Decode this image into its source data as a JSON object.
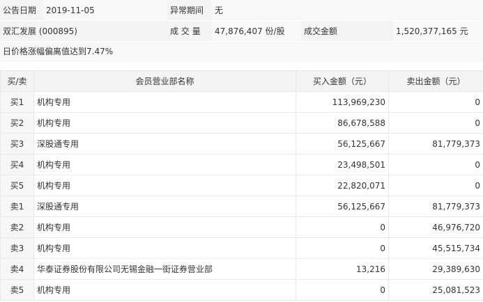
{
  "header": {
    "announce_date_label": "公告日期",
    "announce_date_value": "2019-11-05",
    "abnormal_period_label": "异常期间",
    "abnormal_period_value": "无",
    "stock_name": "双汇发展 (000895)",
    "volume_label": "成 交 量",
    "volume_value": "47,876,407 份/股",
    "amount_label": "成交金额",
    "amount_value": "1,520,377,165 元"
  },
  "reason": "日价格涨幅偏离值达到7.47%",
  "table": {
    "columns": [
      "买/卖",
      "会员营业部名称",
      "买入金额（元）",
      "卖出金额（元）"
    ],
    "rows": [
      {
        "side": "买1",
        "name": "机构专用",
        "buy": "113,969,230",
        "sell": "0"
      },
      {
        "side": "买2",
        "name": "机构专用",
        "buy": "86,678,588",
        "sell": "0"
      },
      {
        "side": "买3",
        "name": "深股通专用",
        "buy": "56,125,667",
        "sell": "81,779,373"
      },
      {
        "side": "买4",
        "name": "机构专用",
        "buy": "23,498,501",
        "sell": "0"
      },
      {
        "side": "买5",
        "name": "机构专用",
        "buy": "22,820,071",
        "sell": "0"
      },
      {
        "side": "卖1",
        "name": "深股通专用",
        "buy": "56,125,667",
        "sell": "81,779,373"
      },
      {
        "side": "卖2",
        "name": "机构专用",
        "buy": "0",
        "sell": "46,976,720"
      },
      {
        "side": "卖3",
        "name": "机构专用",
        "buy": "0",
        "sell": "45,515,734"
      },
      {
        "side": "卖4",
        "name": "华泰证券股份有限公司无锡金融一街证券营业部",
        "buy": "13,216",
        "sell": "29,389,630"
      },
      {
        "side": "卖5",
        "name": "机构专用",
        "buy": "0",
        "sell": "25,081,523"
      }
    ]
  }
}
